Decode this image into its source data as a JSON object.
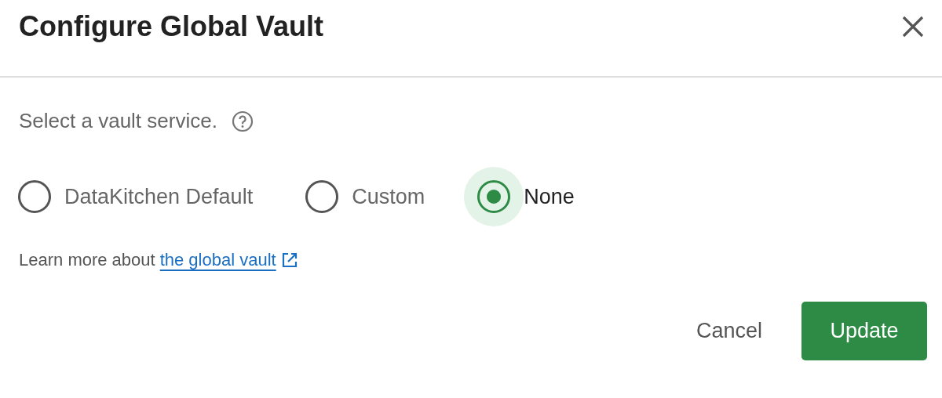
{
  "dialog": {
    "title": "Configure Global Vault",
    "prompt": "Select a vault service.",
    "options": [
      {
        "label": "DataKitchen Default",
        "selected": false
      },
      {
        "label": "Custom",
        "selected": false
      },
      {
        "label": "None",
        "selected": true
      }
    ],
    "learn_more": {
      "text": "Learn more about",
      "link": "the global vault"
    },
    "buttons": [
      {
        "label": "Cancel",
        "kind": "text"
      },
      {
        "label": "Update",
        "kind": "primary"
      }
    ]
  }
}
